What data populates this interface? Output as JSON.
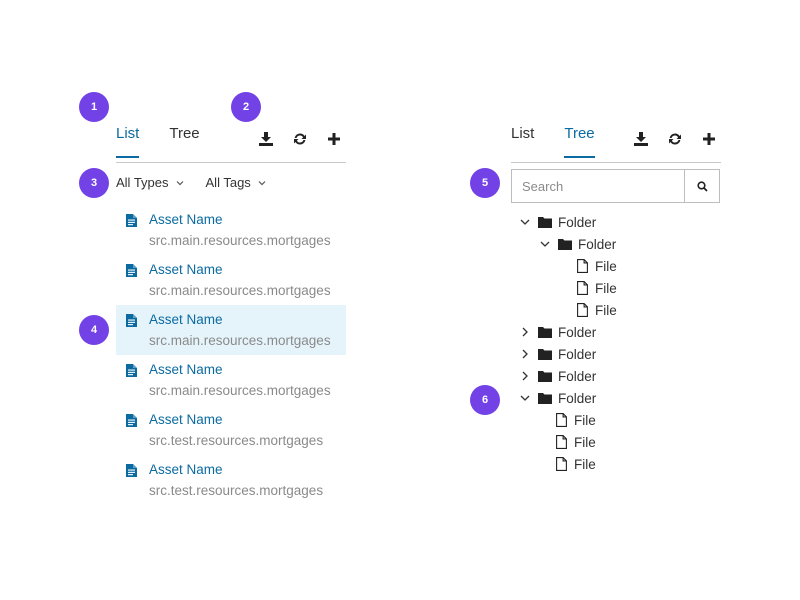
{
  "badges": [
    "1",
    "2",
    "3",
    "4",
    "5",
    "6"
  ],
  "left_panel": {
    "tabs": [
      {
        "label": "List"
      },
      {
        "label": "Tree"
      }
    ],
    "tools": [
      "download-icon",
      "refresh-icon",
      "plus-icon"
    ],
    "filters": [
      {
        "label": "All Types"
      },
      {
        "label": "All Tags"
      }
    ],
    "assets": [
      {
        "name": "Asset Name",
        "path": "src.main.resources.mortgages"
      },
      {
        "name": "Asset Name",
        "path": "src.main.resources.mortgages"
      },
      {
        "name": "Asset Name",
        "path": "src.main.resources.mortgages",
        "selected": true
      },
      {
        "name": "Asset Name",
        "path": "src.main.resources.mortgages"
      },
      {
        "name": "Asset Name",
        "path": "src.test.resources.mortgages"
      },
      {
        "name": "Asset Name",
        "path": "src.test.resources.mortgages"
      }
    ]
  },
  "right_panel": {
    "tabs": [
      {
        "label": "List"
      },
      {
        "label": "Tree"
      }
    ],
    "tools": [
      "download-icon",
      "refresh-icon",
      "plus-icon"
    ],
    "search": {
      "placeholder": "Search",
      "value": ""
    },
    "tree": [
      {
        "type": "folder",
        "label": "Folder",
        "level": 0,
        "expanded": true
      },
      {
        "type": "folder",
        "label": "Folder",
        "level": 1,
        "expanded": true
      },
      {
        "type": "file",
        "label": "File",
        "level": 2
      },
      {
        "type": "file",
        "label": "File",
        "level": 2
      },
      {
        "type": "file",
        "label": "File",
        "level": 2
      },
      {
        "type": "folder",
        "label": "Folder",
        "level": 0,
        "expanded": false
      },
      {
        "type": "folder",
        "label": "Folder",
        "level": 0,
        "expanded": false
      },
      {
        "type": "folder",
        "label": "Folder",
        "level": 0,
        "expanded": false
      },
      {
        "type": "folder",
        "label": "Folder",
        "level": 0,
        "expanded": true
      },
      {
        "type": "file",
        "label": "File",
        "level": 1
      },
      {
        "type": "file",
        "label": "File",
        "level": 1
      },
      {
        "type": "file",
        "label": "File",
        "level": 1
      }
    ]
  },
  "colors": {
    "badge": "#7342e6",
    "accent": "#0b6aa0",
    "selected_bg": "#e5f4fb",
    "path_text": "#8a8a8a"
  }
}
